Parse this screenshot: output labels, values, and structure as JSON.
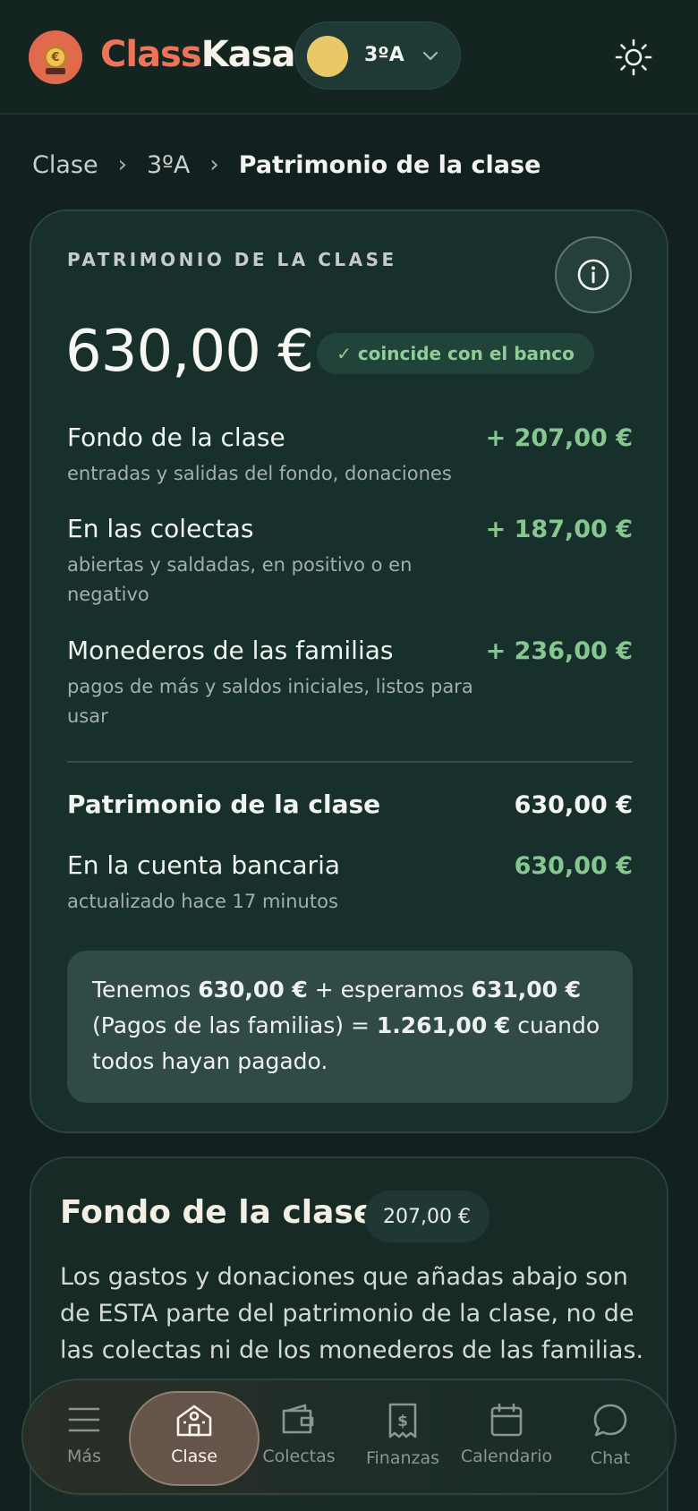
{
  "header": {
    "brand_part1": "Class",
    "brand_part2": "Kasa",
    "class_selector": "3ºA",
    "theme_icon": "sun-icon",
    "logo_icon": "coin-logo-icon"
  },
  "breadcrumb": {
    "items": [
      "Clase",
      "3ºA"
    ],
    "current": "Patrimonio de la clase"
  },
  "summary": {
    "kicker": "PATRIMONIO DE LA CLASE",
    "total": "630,00 €",
    "badge": "✓ coincide con el banco",
    "rows": [
      {
        "label": "Fondo de la clase",
        "sub": "entradas y salidas del fondo, donaciones",
        "value": "+ 207,00 €"
      },
      {
        "label": "En las colectas",
        "sub": "abiertas y saldadas, en positivo o en negativo",
        "value": "+ 187,00 €"
      },
      {
        "label": "Monederos de las familias",
        "sub": "pagos de más y saldos iniciales, listos para usar",
        "value": "+ 236,00 €"
      }
    ],
    "total_row": {
      "label": "Patrimonio de la clase",
      "value": "630,00 €"
    },
    "bank_row": {
      "label": "En la cuenta bancaria",
      "sub": "actualizado hace 17 minutos",
      "value": "630,00 €"
    },
    "note": {
      "t1": "Tenemos ",
      "b1": "630,00 €",
      "t2": " + esperamos ",
      "b2": "631,00 €",
      "t3": " (Pagos de las familias) = ",
      "b3": "1.261,00 €",
      "t4": " cuando todos hayan pagado."
    }
  },
  "fondo": {
    "title": "Fondo de la clase",
    "amount": "207,00 €",
    "description": "Los gastos y donaciones que añadas abajo son de ESTA parte del patrimonio de la clase, no de las colectas ni de los monederos de las familias."
  },
  "nav": {
    "items": [
      {
        "label": "Más",
        "icon": "menu-icon"
      },
      {
        "label": "Clase",
        "icon": "school-icon"
      },
      {
        "label": "Colectas",
        "icon": "wallet-icon"
      },
      {
        "label": "Finanzas",
        "icon": "receipt-icon"
      },
      {
        "label": "Calendario",
        "icon": "calendar-icon"
      },
      {
        "label": "Chat",
        "icon": "chat-icon"
      }
    ],
    "active": "Clase"
  },
  "colors": {
    "accent": "#ec7459",
    "positive": "#86c78f",
    "background": "#12211f"
  }
}
